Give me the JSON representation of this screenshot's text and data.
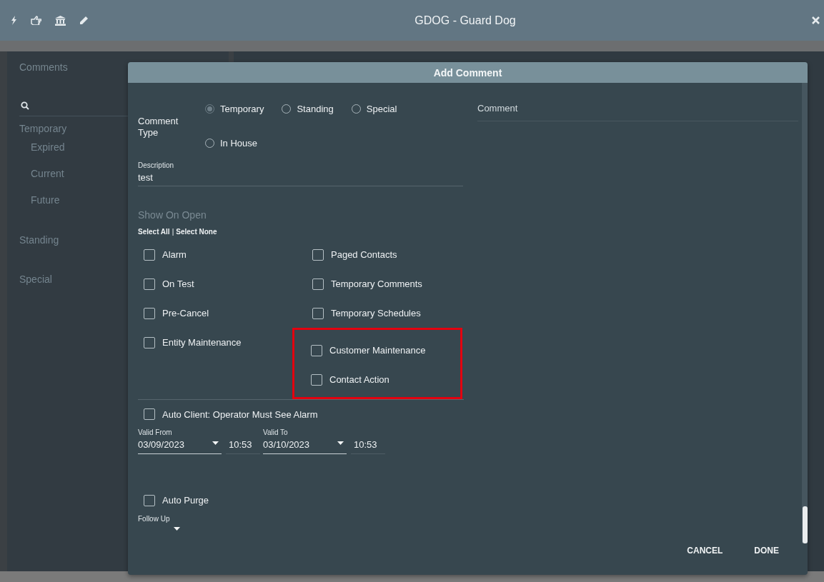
{
  "window": {
    "title": "GDOG - Guard Dog"
  },
  "sidebar": {
    "title": "Comments",
    "groups": [
      {
        "label": "Temporary",
        "children": [
          {
            "label": "Expired"
          },
          {
            "label": "Current"
          },
          {
            "label": "Future"
          }
        ]
      },
      {
        "label": "Standing"
      },
      {
        "label": "Special"
      }
    ]
  },
  "dialog": {
    "title": "Add Comment",
    "comment_type": {
      "label": "Comment Type",
      "options": [
        {
          "label": "Temporary",
          "selected": true
        },
        {
          "label": "Standing",
          "selected": false
        },
        {
          "label": "Special",
          "selected": false
        },
        {
          "label": "In House",
          "selected": false
        }
      ]
    },
    "description": {
      "label": "Description",
      "value": "test"
    },
    "show_on_open": {
      "title": "Show On Open",
      "select_all": "Select All",
      "separator": "|",
      "select_none": "Select None",
      "columns": [
        [
          {
            "label": "Alarm",
            "checked": false,
            "highlighted": false
          },
          {
            "label": "On Test",
            "checked": false,
            "highlighted": false
          },
          {
            "label": "Pre-Cancel",
            "checked": false,
            "highlighted": false
          },
          {
            "label": "Entity Maintenance",
            "checked": false,
            "highlighted": false
          }
        ],
        [
          {
            "label": "Paged Contacts",
            "checked": false,
            "highlighted": false
          },
          {
            "label": "Temporary Comments",
            "checked": false,
            "highlighted": false
          },
          {
            "label": "Temporary Schedules",
            "checked": false,
            "highlighted": false
          },
          {
            "label": "Customer Maintenance",
            "checked": false,
            "highlighted": true
          },
          {
            "label": "Contact Action",
            "checked": false,
            "highlighted": true
          }
        ]
      ]
    },
    "auto_client": {
      "label": "Auto Client: Operator Must See Alarm",
      "checked": false
    },
    "validity": [
      {
        "label": "Valid From",
        "date": "03/09/2023",
        "time": "10:53"
      },
      {
        "label": "Valid To",
        "date": "03/10/2023",
        "time": "10:53"
      }
    ],
    "auto_purge": {
      "label": "Auto Purge",
      "checked": false
    },
    "follow_up": {
      "label": "Follow Up"
    },
    "comment": {
      "label": "Comment"
    },
    "buttons": [
      "CANCEL",
      "DONE"
    ]
  }
}
